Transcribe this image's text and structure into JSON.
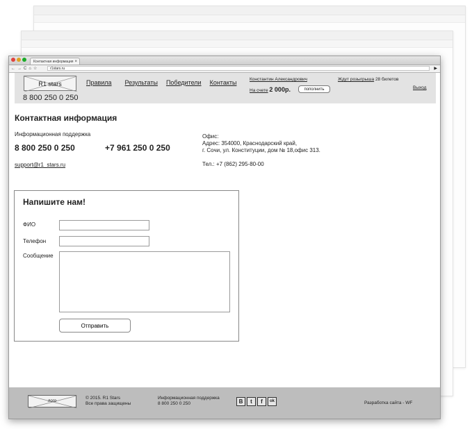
{
  "browser": {
    "tab_title": "Контактная информация",
    "url": "r1stars.ru"
  },
  "header": {
    "logo_text": "R1 stars",
    "phone": "8 800 250 0 250",
    "nav": [
      {
        "label": "Правила"
      },
      {
        "label": "Результаты"
      },
      {
        "label": "Победители"
      },
      {
        "label": "Контакты"
      }
    ],
    "user_name": "Константин Александрович",
    "balance_label": "На счете",
    "balance_value": "2 000р.",
    "topup_label": "пополнить",
    "draw_link": "Ждут розыгрыша",
    "draw_count": "28 билетов",
    "logout_label": "Выход"
  },
  "content": {
    "title": "Контактная информация",
    "support_label": "Информационная поддержка",
    "phone1": "8 800 250 0 250",
    "phone2": "+7 961 250 0 250",
    "email": "support@r1_stars.ru",
    "office_title": "Офис:",
    "office_address1": "Адрес:  354000, Краснодарский край,",
    "office_address2": "г. Сочи, ул. Конституции, дом № 18,офис 313.",
    "office_tel": "Тел.: +7 (862) 295-80-00"
  },
  "form": {
    "title": "Напишите нам!",
    "name_label": "ФИО",
    "name_value": "",
    "phone_label": "Телефон",
    "phone_value": "",
    "message_label": "Сообщение",
    "message_value": "",
    "submit_label": "Отправить"
  },
  "footer": {
    "logo_text": "лого",
    "copyright_line1": "© 2015. R1 Stars",
    "copyright_line2": "Все права защищены",
    "support_line1": "Информационная поддержка",
    "support_line2": "8 800 250 0 250",
    "social": [
      {
        "glyph": "В",
        "icon": "vk-icon"
      },
      {
        "glyph": "t",
        "icon": "twitter-icon"
      },
      {
        "glyph": "f",
        "icon": "facebook-icon"
      },
      {
        "glyph": "ok",
        "icon": "odnoklassniki-icon"
      }
    ],
    "developer": "Разработка сайта - WF"
  },
  "colors": {
    "header_bg": "#e3e3e3",
    "footer_bg": "#bdbdbd",
    "traffic_red": "#e0443e",
    "traffic_yellow": "#dea123",
    "traffic_green": "#1aab29"
  }
}
